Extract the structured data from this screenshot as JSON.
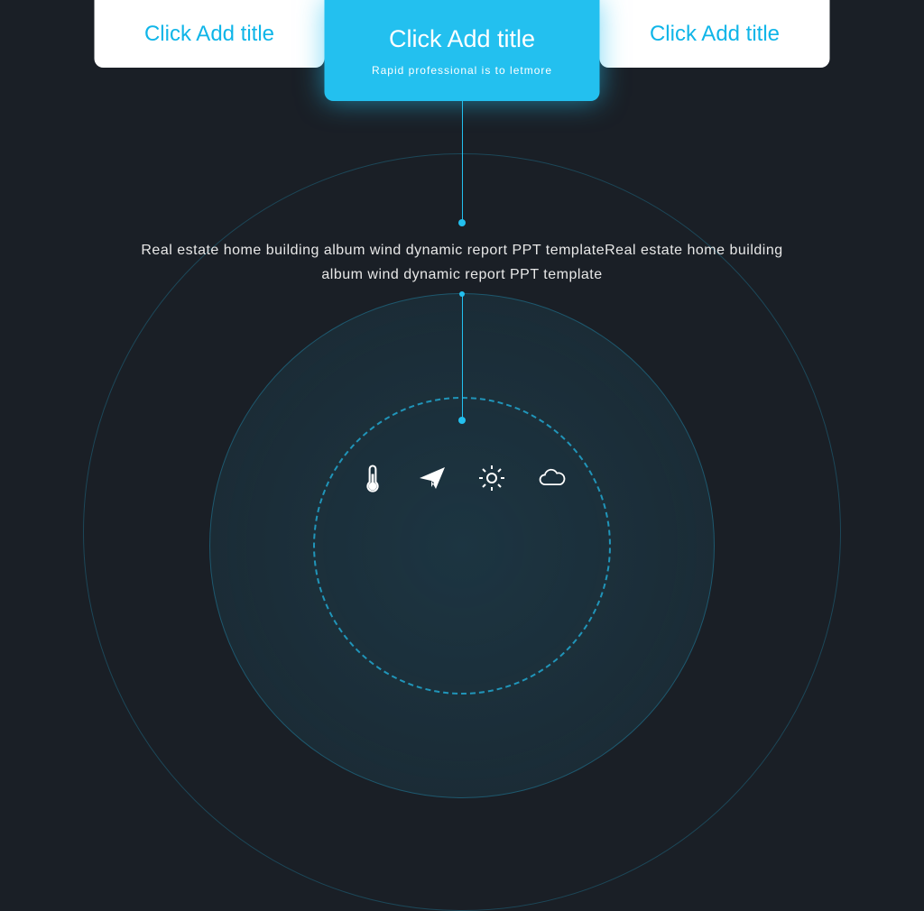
{
  "tabs": {
    "left": {
      "label": "Click Add title"
    },
    "center": {
      "label": "Click Add title",
      "subtitle": "Rapid professional is to letmore"
    },
    "right": {
      "label": "Click Add title"
    }
  },
  "description": "Real estate home building album wind dynamic report PPT templateReal estate home building album wind dynamic report PPT template",
  "icons": {
    "thermometer": "thermometer-icon",
    "paperplane": "paper-plane-icon",
    "sun": "sun-icon",
    "cloud": "cloud-icon"
  },
  "colors": {
    "accent": "#23c0ef",
    "background": "#1a1f26",
    "white": "#ffffff"
  }
}
